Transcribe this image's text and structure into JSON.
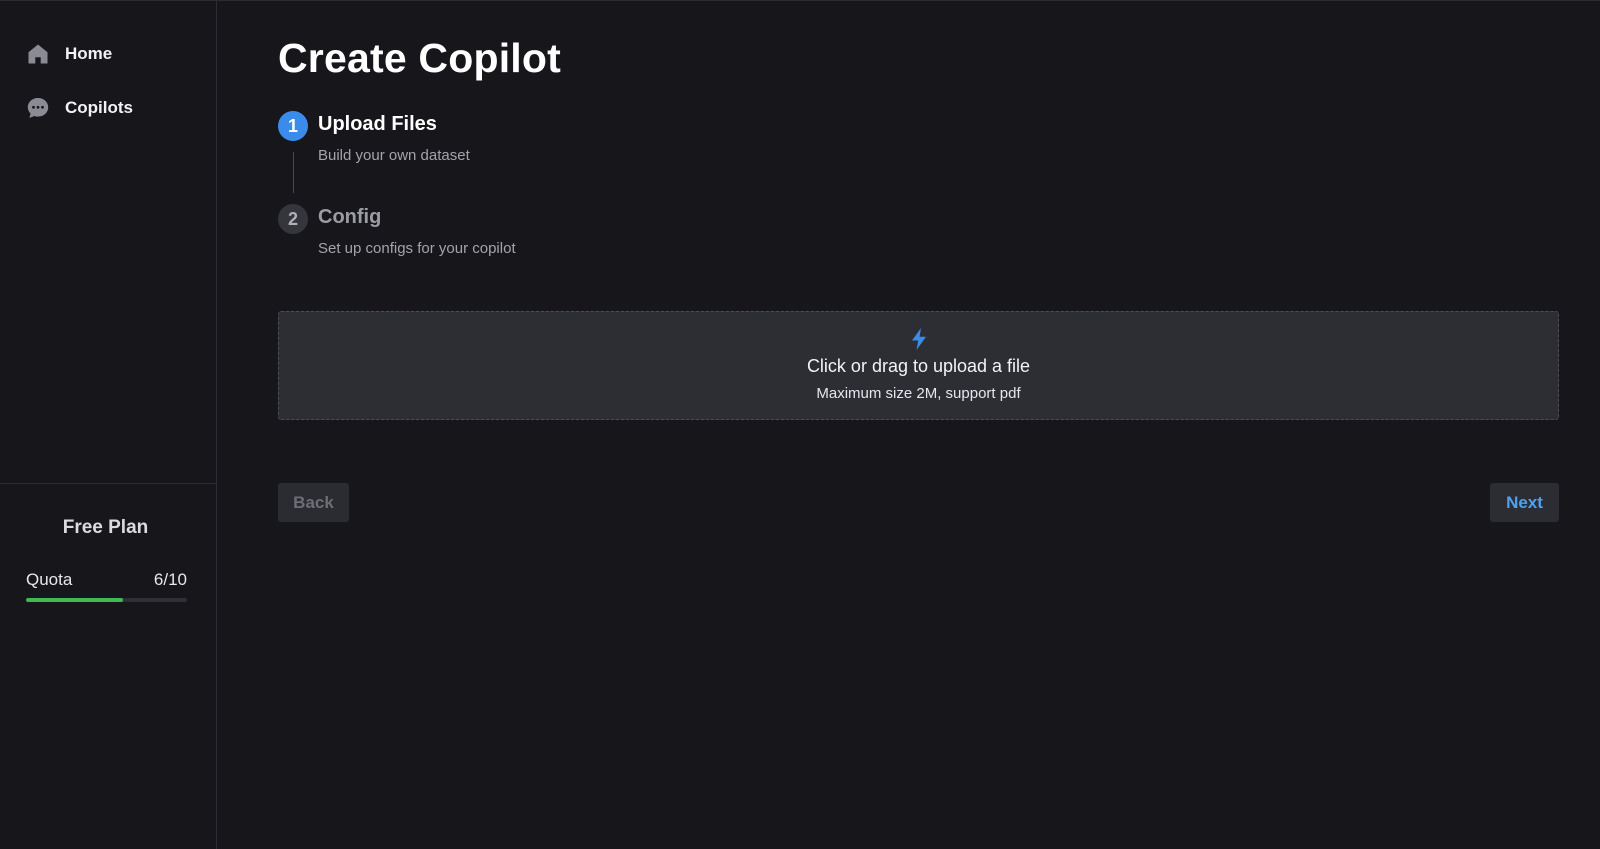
{
  "sidebar": {
    "nav": [
      {
        "label": "Home",
        "icon": "home-icon"
      },
      {
        "label": "Copilots",
        "icon": "chat-icon"
      }
    ],
    "plan": {
      "title": "Free Plan",
      "quota_label": "Quota",
      "quota_value": "6/10",
      "quota_used": 6,
      "quota_total": 10,
      "quota_color": "#3fb950"
    }
  },
  "main": {
    "title": "Create Copilot",
    "steps": [
      {
        "number": "1",
        "title": "Upload Files",
        "description": "Build your own dataset",
        "active": true
      },
      {
        "number": "2",
        "title": "Config",
        "description": "Set up configs for your copilot",
        "active": false
      }
    ],
    "upload": {
      "icon": "lightning-icon",
      "text": "Click or drag to upload a file",
      "hint": "Maximum size 2M, support pdf"
    },
    "buttons": {
      "back": "Back",
      "next": "Next"
    }
  },
  "colors": {
    "background": "#17171b",
    "accent": "#3b8beb",
    "link": "#4ea3f0",
    "success": "#3fb950"
  }
}
